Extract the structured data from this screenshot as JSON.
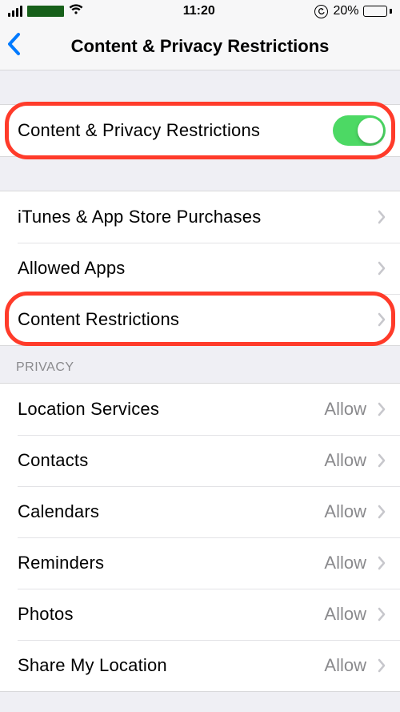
{
  "statusbar": {
    "time": "11:20",
    "battery_pct": "20%"
  },
  "nav": {
    "title": "Content & Privacy Restrictions"
  },
  "section1": {
    "row0_label": "Content & Privacy Restrictions",
    "toggle_on": true
  },
  "section2": {
    "rows": [
      {
        "label": "iTunes & App Store Purchases"
      },
      {
        "label": "Allowed Apps"
      },
      {
        "label": "Content Restrictions"
      }
    ]
  },
  "section3": {
    "header": "PRIVACY",
    "rows": [
      {
        "label": "Location Services",
        "value": "Allow"
      },
      {
        "label": "Contacts",
        "value": "Allow"
      },
      {
        "label": "Calendars",
        "value": "Allow"
      },
      {
        "label": "Reminders",
        "value": "Allow"
      },
      {
        "label": "Photos",
        "value": "Allow"
      },
      {
        "label": "Share My Location",
        "value": "Allow"
      }
    ]
  },
  "colors": {
    "highlight": "#ff3b2a",
    "toggle_on": "#4cd964",
    "link": "#007aff"
  }
}
